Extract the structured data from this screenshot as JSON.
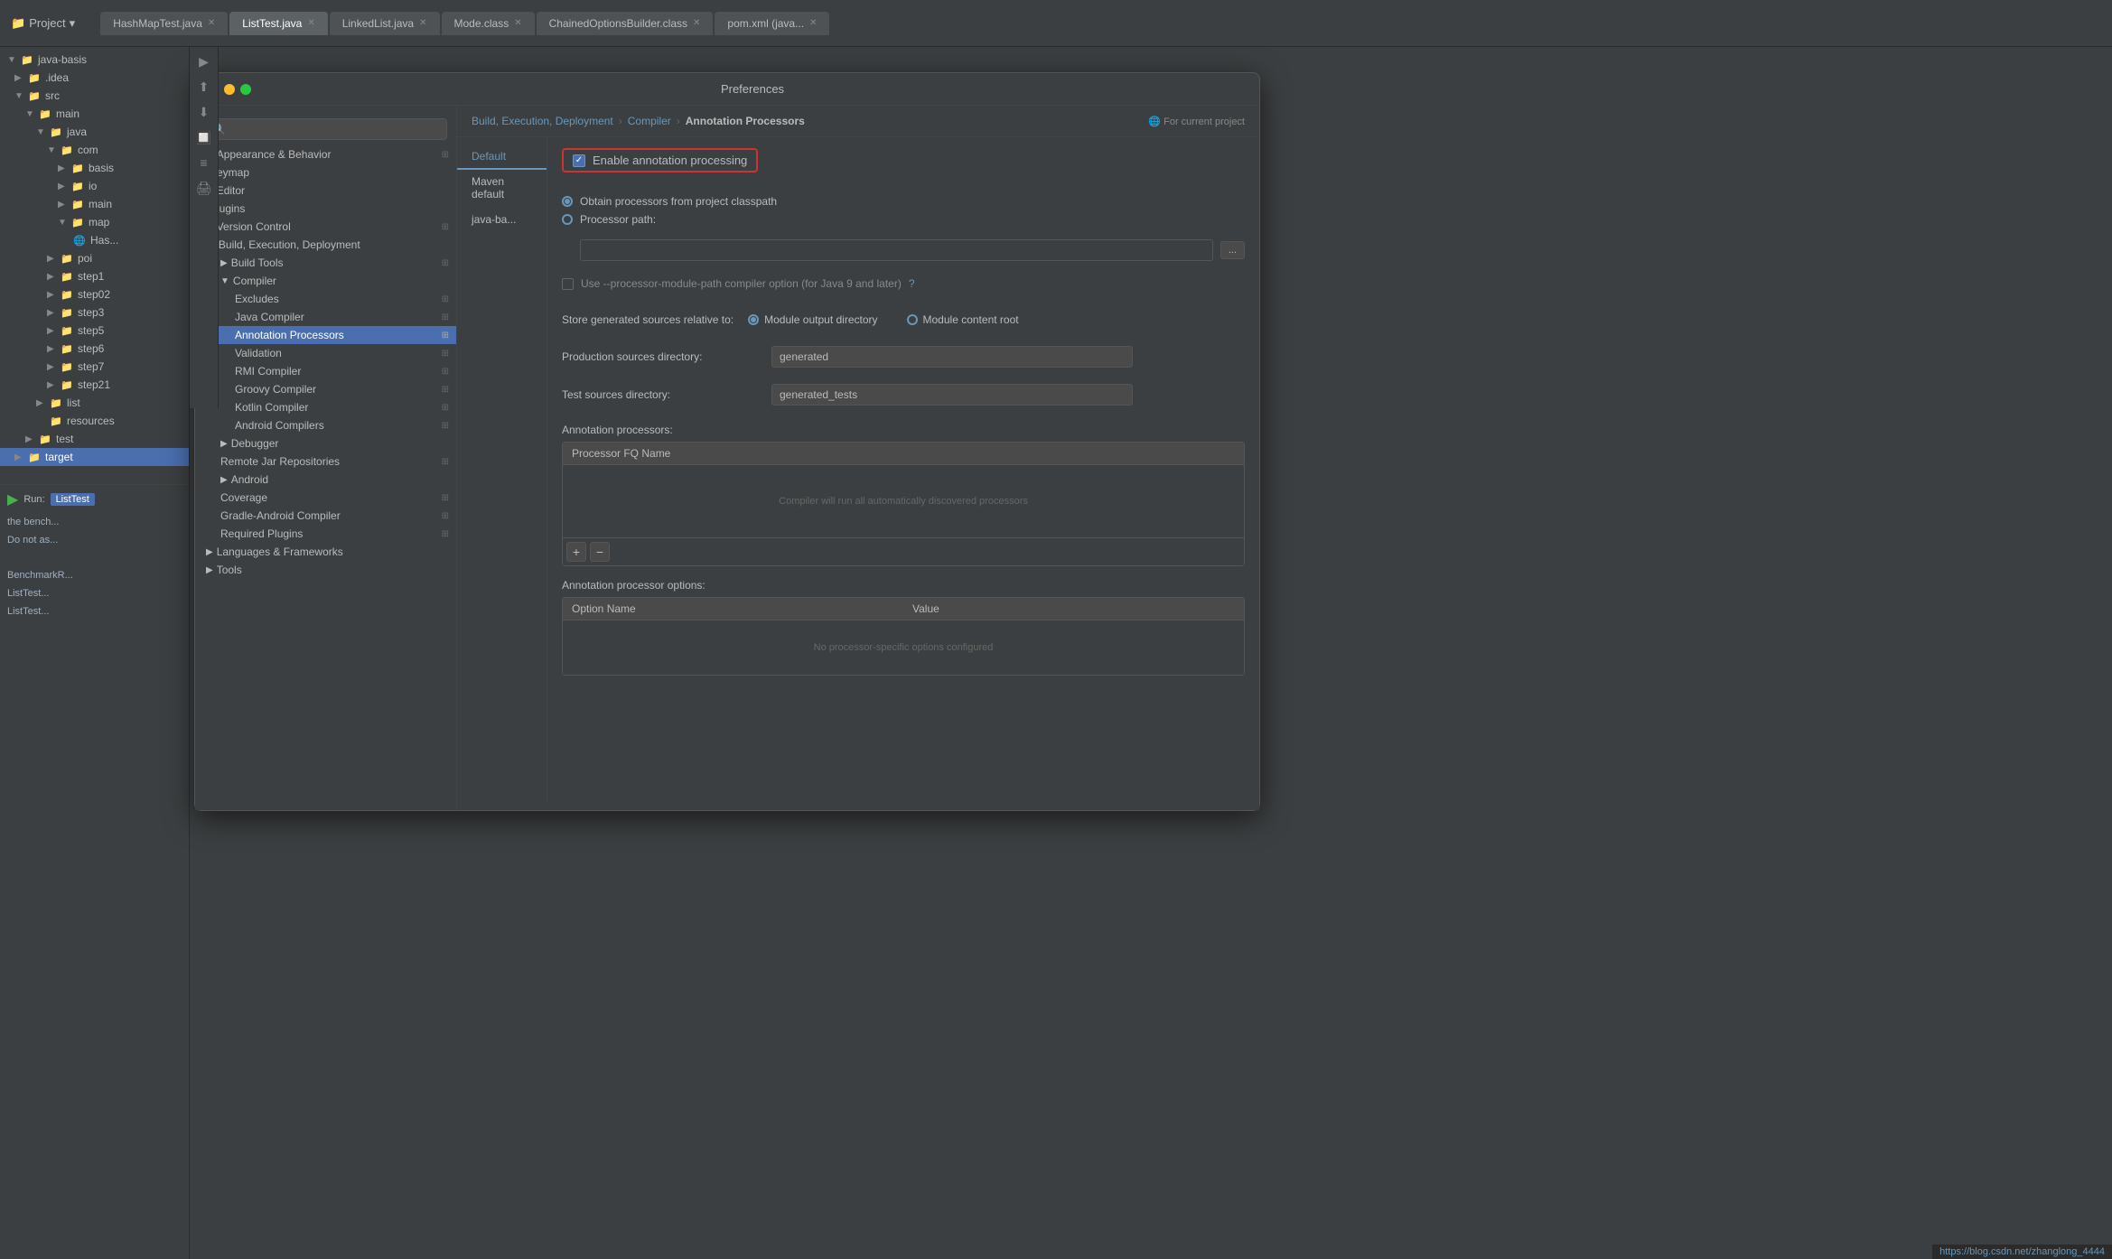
{
  "topbar": {
    "project_label": "Project",
    "tabs": [
      {
        "label": "HashMapTest.java",
        "active": false
      },
      {
        "label": "ListTest.java",
        "active": true
      },
      {
        "label": "LinkedList.java",
        "active": false
      },
      {
        "label": "Mode.class",
        "active": false
      },
      {
        "label": "ChainedOptionsBuilder.class",
        "active": false
      },
      {
        "label": "pom.xml (java...",
        "active": false
      }
    ]
  },
  "project_tree": {
    "root": "java-basis",
    "root_path": "/workspace/java-basis",
    "items": [
      {
        "label": ".idea",
        "level": 1,
        "type": "folder",
        "expanded": false
      },
      {
        "label": "src",
        "level": 1,
        "type": "folder",
        "expanded": true
      },
      {
        "label": "main",
        "level": 2,
        "type": "folder",
        "expanded": true
      },
      {
        "label": "java",
        "level": 3,
        "type": "folder",
        "expanded": true
      },
      {
        "label": "com",
        "level": 4,
        "type": "folder",
        "expanded": true
      },
      {
        "label": "basis",
        "level": 5,
        "type": "folder",
        "expanded": false
      },
      {
        "label": "io",
        "level": 5,
        "type": "folder",
        "expanded": false
      },
      {
        "label": "main",
        "level": 5,
        "type": "folder",
        "expanded": false
      },
      {
        "label": "map",
        "level": 5,
        "type": "folder",
        "expanded": true
      },
      {
        "label": "Has...",
        "level": 6,
        "type": "file"
      },
      {
        "label": "poi",
        "level": 4,
        "type": "folder",
        "expanded": false
      },
      {
        "label": "step1",
        "level": 4,
        "type": "folder",
        "expanded": false
      },
      {
        "label": "step02",
        "level": 4,
        "type": "folder",
        "expanded": false
      },
      {
        "label": "step3",
        "level": 4,
        "type": "folder",
        "expanded": false
      },
      {
        "label": "step5",
        "level": 4,
        "type": "folder",
        "expanded": false
      },
      {
        "label": "step6",
        "level": 4,
        "type": "folder",
        "expanded": false
      },
      {
        "label": "step7",
        "level": 4,
        "type": "folder",
        "expanded": false
      },
      {
        "label": "step21",
        "level": 4,
        "type": "folder",
        "expanded": false
      },
      {
        "label": "list",
        "level": 3,
        "type": "folder",
        "expanded": false
      },
      {
        "label": "resources",
        "level": 3,
        "type": "folder",
        "expanded": false
      },
      {
        "label": "test",
        "level": 2,
        "type": "folder",
        "expanded": false
      },
      {
        "label": "target",
        "level": 1,
        "type": "folder",
        "expanded": false,
        "selected": true
      }
    ]
  },
  "dialog": {
    "title": "Preferences",
    "breadcrumb": {
      "parts": [
        "Build, Execution, Deployment",
        "Compiler",
        "Annotation Processors"
      ],
      "for_current_project": "For current project"
    },
    "settings_tree": {
      "search_placeholder": "🔍",
      "items": [
        {
          "label": "Appearance & Behavior",
          "level": 1,
          "expanded": true,
          "arrow": "▶"
        },
        {
          "label": "Keymap",
          "level": 1,
          "arrow": ""
        },
        {
          "label": "Editor",
          "level": 1,
          "expanded": true,
          "arrow": "▶"
        },
        {
          "label": "Plugins",
          "level": 1,
          "arrow": ""
        },
        {
          "label": "Version Control",
          "level": 1,
          "expanded": true,
          "arrow": "▶"
        },
        {
          "label": "Build, Execution, Deployment",
          "level": 1,
          "expanded": true,
          "arrow": "▼"
        },
        {
          "label": "Build Tools",
          "level": 2,
          "expanded": true,
          "arrow": "▶"
        },
        {
          "label": "Compiler",
          "level": 2,
          "expanded": true,
          "arrow": "▼"
        },
        {
          "label": "Excludes",
          "level": 3,
          "arrow": ""
        },
        {
          "label": "Java Compiler",
          "level": 3,
          "arrow": ""
        },
        {
          "label": "Annotation Processors",
          "level": 3,
          "arrow": "",
          "selected": true
        },
        {
          "label": "Validation",
          "level": 3,
          "arrow": ""
        },
        {
          "label": "RMI Compiler",
          "level": 3,
          "arrow": ""
        },
        {
          "label": "Groovy Compiler",
          "level": 3,
          "arrow": ""
        },
        {
          "label": "Kotlin Compiler",
          "level": 3,
          "arrow": ""
        },
        {
          "label": "Android Compilers",
          "level": 3,
          "arrow": ""
        },
        {
          "label": "Debugger",
          "level": 2,
          "expanded": true,
          "arrow": "▶"
        },
        {
          "label": "Remote Jar Repositories",
          "level": 2,
          "arrow": ""
        },
        {
          "label": "Android",
          "level": 2,
          "expanded": true,
          "arrow": "▶"
        },
        {
          "label": "Coverage",
          "level": 2,
          "arrow": ""
        },
        {
          "label": "Gradle-Android Compiler",
          "level": 2,
          "arrow": ""
        },
        {
          "label": "Required Plugins",
          "level": 2,
          "arrow": ""
        },
        {
          "label": "Languages & Frameworks",
          "level": 1,
          "expanded": true,
          "arrow": "▶"
        },
        {
          "label": "Tools",
          "level": 1,
          "expanded": true,
          "arrow": "▶"
        }
      ]
    },
    "content": {
      "profile_tabs": [
        {
          "label": "Default",
          "active": true
        },
        {
          "label": "Maven default",
          "active": false
        },
        {
          "label": "java-ba...",
          "active": false
        }
      ],
      "enable_annotation_processing": {
        "label": "Enable annotation processing",
        "checked": true
      },
      "processor_source": {
        "label": "Obtain processors from project classpath",
        "options": [
          {
            "label": "Obtain processors from project classpath",
            "selected": true
          },
          {
            "label": "Processor path:",
            "selected": false
          }
        ]
      },
      "processor_path": "",
      "use_module_path": {
        "label": "Use --processor-module-path compiler option (for Java 9 and later)",
        "checked": false
      },
      "store_generated": {
        "label": "Store generated sources relative to:",
        "options": [
          {
            "label": "Module output directory",
            "selected": true
          },
          {
            "label": "Module content root",
            "selected": false
          }
        ]
      },
      "production_sources": {
        "label": "Production sources directory:",
        "value": "generated"
      },
      "test_sources": {
        "label": "Test sources directory:",
        "value": "generated_tests"
      },
      "annotation_processors": {
        "label": "Annotation processors:",
        "table_header": "Processor FQ Name",
        "hint": "Compiler will run all automatically discovered processors",
        "add_btn": "+",
        "remove_btn": "−"
      },
      "annotation_options": {
        "label": "Annotation processor options:",
        "col1": "Option Name",
        "col2": "Value",
        "hint": "No processor-specific options configured"
      }
    }
  },
  "run_bar": {
    "run_label": "Run:",
    "tab_label": "ListTest",
    "lines": [
      "the bench...",
      "Do not as...",
      "",
      "BenchmarkR...",
      "ListTest...",
      "ListTest..."
    ]
  },
  "status_bar": {
    "url": "https://blog.csdn.net/zhanglong_4444"
  }
}
